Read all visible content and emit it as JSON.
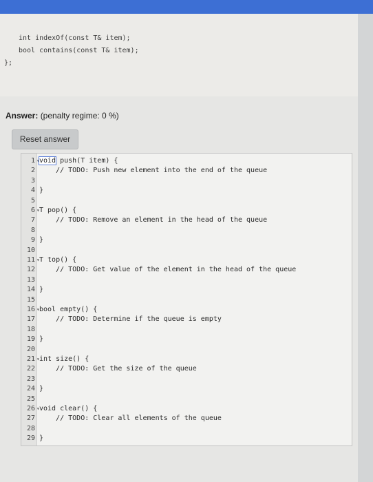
{
  "prev_code": {
    "line1": "int indexOf(const T& item);",
    "line2": "bool contains(const T& item);",
    "line3": "};"
  },
  "answer": {
    "label": "Answer:",
    "penalty": "(penalty regime: 0 %)"
  },
  "reset_button": "Reset answer",
  "editor_lines": [
    {
      "n": "1",
      "t": "void push(T item) {"
    },
    {
      "n": "2",
      "t": "    // TODO: Push new element into the end of the queue"
    },
    {
      "n": "3",
      "t": ""
    },
    {
      "n": "4",
      "t": "}"
    },
    {
      "n": "5",
      "t": ""
    },
    {
      "n": "6",
      "t": "T pop() {"
    },
    {
      "n": "7",
      "t": "    // TODO: Remove an element in the head of the queue"
    },
    {
      "n": "8",
      "t": ""
    },
    {
      "n": "9",
      "t": "}"
    },
    {
      "n": "10",
      "t": ""
    },
    {
      "n": "11",
      "t": "T top() {"
    },
    {
      "n": "12",
      "t": "    // TODO: Get value of the element in the head of the queue"
    },
    {
      "n": "13",
      "t": ""
    },
    {
      "n": "14",
      "t": "}"
    },
    {
      "n": "15",
      "t": ""
    },
    {
      "n": "16",
      "t": "bool empty() {"
    },
    {
      "n": "17",
      "t": "    // TODO: Determine if the queue is empty"
    },
    {
      "n": "18",
      "t": ""
    },
    {
      "n": "19",
      "t": "}"
    },
    {
      "n": "20",
      "t": ""
    },
    {
      "n": "21",
      "t": "int size() {"
    },
    {
      "n": "22",
      "t": "    // TODO: Get the size of the queue"
    },
    {
      "n": "23",
      "t": ""
    },
    {
      "n": "24",
      "t": "}"
    },
    {
      "n": "25",
      "t": ""
    },
    {
      "n": "26",
      "t": "void clear() {"
    },
    {
      "n": "27",
      "t": "    // TODO: Clear all elements of the queue"
    },
    {
      "n": "28",
      "t": ""
    },
    {
      "n": "29",
      "t": "}"
    }
  ]
}
